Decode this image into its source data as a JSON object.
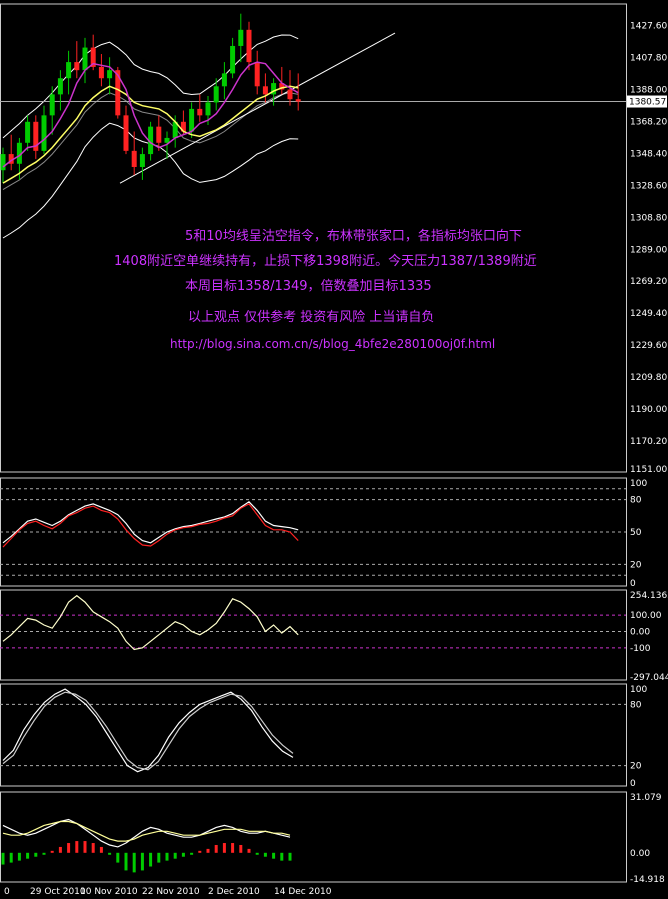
{
  "annotations": [
    "5和10均线呈沽空指令，布林带张家口，各指标均张口向下",
    "1408附近空单继续持有，止损下移1398附近。今天压力1387/1389附近",
    "本周目标1358/1349，倍数叠加目标1335",
    "以上观点 仅供参考 投资有风险 上当请自负",
    "http://blog.sina.com.cn/s/blog_4bfe2e280100oj0f.html"
  ],
  "current_price": "1380.57",
  "x_labels": [
    "0",
    "29 Oct 2010",
    "10 Nov 2010",
    "22 Nov 2010",
    "2 Dec 2010",
    "14 Dec 2010"
  ],
  "colors": {
    "bull": "#00cc00",
    "bear": "#ff2222",
    "ma5": "#cc33cc",
    "ma10": "#ffff66",
    "ma20": "#888888",
    "boll": "#ffffff"
  },
  "chart_data": [
    {
      "type": "candlestick",
      "title": "",
      "y_ticks": [
        "1427.60",
        "1407.80",
        "1388.00",
        "1368.20",
        "1348.40",
        "1328.60",
        "1308.80",
        "1289.00",
        "1269.20",
        "1249.40",
        "1229.60",
        "1209.80",
        "1190.00",
        "1170.20",
        "1151.00"
      ],
      "ylim": [
        1151,
        1441
      ],
      "ohlc": [
        [
          1338,
          1352,
          1330,
          1348
        ],
        [
          1348,
          1360,
          1338,
          1342
        ],
        [
          1342,
          1358,
          1332,
          1355
        ],
        [
          1355,
          1372,
          1350,
          1368
        ],
        [
          1368,
          1372,
          1345,
          1350
        ],
        [
          1350,
          1378,
          1348,
          1372
        ],
        [
          1372,
          1390,
          1360,
          1385
        ],
        [
          1385,
          1400,
          1375,
          1395
        ],
        [
          1395,
          1412,
          1385,
          1405
        ],
        [
          1405,
          1418,
          1395,
          1400
        ],
        [
          1400,
          1420,
          1392,
          1414
        ],
        [
          1414,
          1422,
          1400,
          1402
        ],
        [
          1402,
          1410,
          1390,
          1395
        ],
        [
          1395,
          1408,
          1385,
          1400
        ],
        [
          1400,
          1402,
          1370,
          1372
        ],
        [
          1372,
          1378,
          1348,
          1350
        ],
        [
          1350,
          1362,
          1335,
          1340
        ],
        [
          1340,
          1352,
          1332,
          1348
        ],
        [
          1348,
          1368,
          1344,
          1365
        ],
        [
          1365,
          1372,
          1350,
          1355
        ],
        [
          1355,
          1362,
          1345,
          1358
        ],
        [
          1358,
          1372,
          1352,
          1368
        ],
        [
          1368,
          1375,
          1360,
          1362
        ],
        [
          1362,
          1380,
          1358,
          1376
        ],
        [
          1376,
          1385,
          1368,
          1372
        ],
        [
          1372,
          1384,
          1366,
          1380
        ],
        [
          1380,
          1395,
          1375,
          1390
        ],
        [
          1390,
          1405,
          1382,
          1398
        ],
        [
          1398,
          1420,
          1395,
          1415
        ],
        [
          1415,
          1435,
          1405,
          1425
        ],
        [
          1425,
          1430,
          1400,
          1405
        ],
        [
          1405,
          1412,
          1385,
          1390
        ],
        [
          1390,
          1398,
          1380,
          1385
        ],
        [
          1385,
          1395,
          1378,
          1392
        ],
        [
          1392,
          1402,
          1385,
          1388
        ],
        [
          1388,
          1400,
          1378,
          1382
        ],
        [
          1382,
          1398,
          1375,
          1380.57
        ]
      ],
      "ma5": [
        1340,
        1344,
        1347,
        1352,
        1353,
        1357,
        1362,
        1370,
        1379,
        1392,
        1400,
        1404,
        1403,
        1402,
        1397,
        1388,
        1372,
        1361,
        1355,
        1352,
        1354,
        1358,
        1360,
        1362,
        1367,
        1369,
        1373,
        1380,
        1388,
        1397,
        1403,
        1405,
        1404,
        1398,
        1392,
        1389,
        1386
      ],
      "ma10": [
        1330,
        1333,
        1336,
        1340,
        1343,
        1347,
        1352,
        1358,
        1364,
        1370,
        1378,
        1383,
        1387,
        1390,
        1388,
        1385,
        1380,
        1378,
        1377,
        1376,
        1373,
        1368,
        1362,
        1360,
        1359,
        1361,
        1363,
        1366,
        1370,
        1374,
        1378,
        1382,
        1384,
        1387,
        1389,
        1390,
        1389
      ]
    },
    {
      "type": "line",
      "title": "",
      "y_ticks": [
        "100",
        "80",
        "50",
        "20",
        "0"
      ],
      "ylim": [
        0,
        100
      ],
      "levels": [
        90,
        80,
        50,
        20,
        10
      ],
      "series": [
        {
          "values": [
            40,
            46,
            53,
            60,
            62,
            59,
            56,
            60,
            66,
            70,
            74,
            76,
            73,
            70,
            66,
            58,
            48,
            42,
            40,
            45,
            50,
            53,
            55,
            56,
            58,
            60,
            62,
            64,
            67,
            73,
            78,
            70,
            60,
            56,
            55,
            54,
            52
          ]
        },
        {
          "values": [
            36,
            44,
            52,
            58,
            60,
            56,
            53,
            58,
            65,
            68,
            72,
            74,
            70,
            68,
            62,
            52,
            44,
            38,
            37,
            42,
            48,
            52,
            54,
            55,
            57,
            58,
            60,
            63,
            65,
            72,
            76,
            66,
            56,
            52,
            52,
            50,
            42
          ]
        }
      ]
    },
    {
      "type": "line",
      "title": "",
      "y_ticks": [
        "254.1365",
        "100.00",
        "0.00",
        "-100",
        "-297.044"
      ],
      "ylim": [
        -297.044,
        254.1365
      ],
      "levels": [
        100,
        0,
        -100
      ],
      "series": [
        {
          "values": [
            -60,
            -20,
            30,
            80,
            70,
            40,
            20,
            90,
            180,
            220,
            180,
            120,
            90,
            60,
            20,
            -60,
            -110,
            -100,
            -60,
            -20,
            20,
            60,
            40,
            0,
            -20,
            10,
            50,
            120,
            200,
            180,
            140,
            90,
            0,
            40,
            -10,
            30,
            -20
          ]
        }
      ]
    },
    {
      "type": "line",
      "title": "",
      "y_ticks": [
        "100",
        "80",
        "20",
        "0"
      ],
      "ylim": [
        0,
        100
      ],
      "levels": [
        80,
        20
      ],
      "series": [
        {
          "values": [
            25,
            35,
            55,
            70,
            82,
            90,
            95,
            88,
            80,
            68,
            52,
            36,
            20,
            14,
            18,
            30,
            48,
            62,
            72,
            80,
            84,
            88,
            92,
            85,
            74,
            58,
            44,
            34,
            28
          ]
        },
        {
          "values": [
            22,
            30,
            48,
            64,
            78,
            87,
            92,
            90,
            84,
            72,
            58,
            42,
            26,
            18,
            16,
            24,
            40,
            56,
            68,
            76,
            82,
            86,
            90,
            88,
            78,
            64,
            50,
            40,
            32
          ]
        }
      ]
    },
    {
      "type": "bar",
      "title": "",
      "y_ticks": [
        "31.079",
        "0.00",
        "-14.918"
      ],
      "ylim": [
        -14.918,
        31.079
      ],
      "histogram": [
        -6,
        -5,
        -4,
        -3,
        -2,
        -1,
        1,
        3,
        5,
        6,
        6,
        5,
        3,
        -1,
        -5,
        -9,
        -10,
        -9,
        -7,
        -5,
        -4,
        -3,
        -2,
        -1,
        1,
        2,
        4,
        5,
        5,
        4,
        2,
        -1,
        -2,
        -3,
        -4,
        -4
      ],
      "series": [
        {
          "values": [
            14,
            12,
            10,
            9,
            10,
            12,
            14,
            16,
            17,
            15,
            12,
            9,
            6,
            4,
            3,
            5,
            8,
            11,
            13,
            12,
            10,
            9,
            8,
            8,
            9,
            11,
            13,
            14,
            13,
            11,
            10,
            10,
            11,
            10,
            9,
            8
          ]
        },
        {
          "values": [
            10,
            9,
            9,
            10,
            12,
            14,
            15,
            16,
            16,
            15,
            13,
            11,
            9,
            7,
            6,
            6,
            7,
            9,
            10,
            11,
            11,
            10,
            9,
            9,
            9,
            10,
            11,
            12,
            12,
            12,
            11,
            11,
            11,
            10,
            10,
            9
          ]
        }
      ]
    }
  ]
}
